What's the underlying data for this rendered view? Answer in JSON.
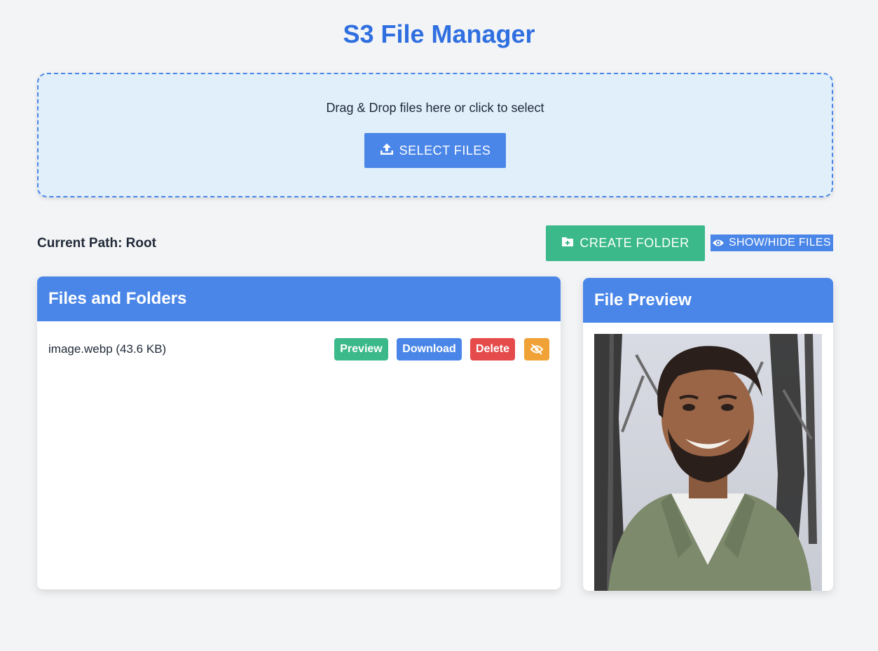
{
  "app": {
    "title": "S3 File Manager"
  },
  "upload": {
    "drop_text": "Drag & Drop files here or click to select",
    "select_label": "SELECT FILES",
    "select_icon": "upload-icon"
  },
  "toolbar": {
    "current_path": "Current Path: Root",
    "create_folder_label": "CREATE FOLDER",
    "create_folder_icon": "folder-plus-icon",
    "show_hide_label": "SHOW/HIDE FILES",
    "show_hide_icon": "eye-icon"
  },
  "files_panel": {
    "title": "Files and Folders",
    "items": [
      {
        "name": "image.webp (43.6 KB)",
        "preview_label": "Preview",
        "download_label": "Download",
        "delete_label": "Delete",
        "hide_icon": "eye-slash-icon"
      }
    ]
  },
  "preview_panel": {
    "title": "File Preview"
  },
  "colors": {
    "brand_blue": "#4a86e8",
    "title_blue": "#2f6fe0",
    "green": "#3bb98a",
    "red": "#e64b4b",
    "orange": "#f0a237",
    "page_bg": "#f3f4f6",
    "dropzone_bg": "#e1effb"
  }
}
